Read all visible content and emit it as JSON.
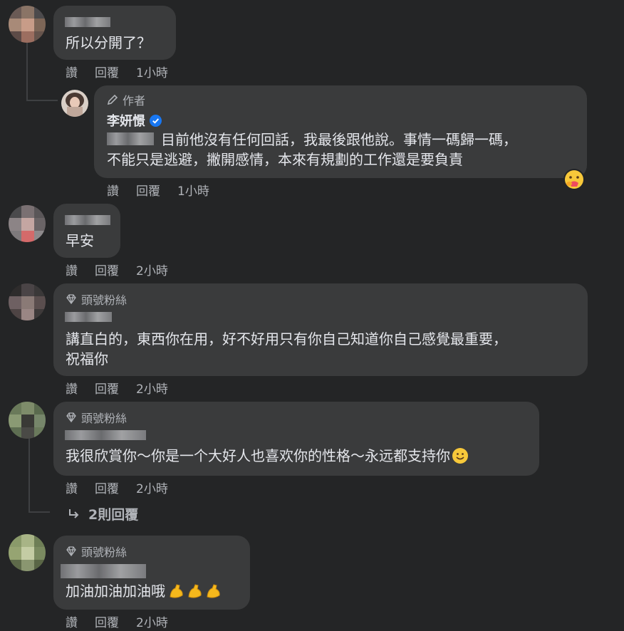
{
  "comments": [
    {
      "text": "所以分開了？",
      "like": "讚",
      "reply": "回覆",
      "time": "1小時"
    },
    {
      "badge": "作者",
      "author": "李妍憬",
      "text_line1": "目前他沒有任何回話，我最後跟他說。事情一碼歸一碼，",
      "text_line2": "不能只是逃避，撇開感情，本來有規劃的工作還是要負責",
      "like": "讚",
      "reply": "回覆",
      "time": "1小時"
    },
    {
      "text": "早安",
      "like": "讚",
      "reply": "回覆",
      "time": "2小時"
    },
    {
      "badge": "頭號粉絲",
      "text_line1": "講直白的，東西你在用，好不好用只有你自己知道你自己感覺最重要，",
      "text_line2": "祝福你",
      "like": "讚",
      "reply": "回覆",
      "time": "2小時"
    },
    {
      "badge": "頭號粉絲",
      "text": "我很欣賞你～你是一个大好人也喜欢你的性格～永远都支持你",
      "like": "讚",
      "reply": "回覆",
      "time": "2小時",
      "replies_link": "2則回覆"
    },
    {
      "badge": "頭號粉絲",
      "text": "加油加油加油哦",
      "like": "讚",
      "reply": "回覆",
      "time": "2小時"
    }
  ],
  "icons": {
    "pencil": "pencil-icon",
    "verified": "verified-badge-icon",
    "diamond": "diamond-icon",
    "reply_arrow": "reply-arrow-icon",
    "care": "care-reaction-icon",
    "smile": "smile-emoji",
    "muscle": "flexed-biceps-emoji"
  },
  "colors": {
    "background": "#242526",
    "bubble": "#3a3b3c",
    "text": "#e4e6eb",
    "secondary": "#b0b3b8",
    "verified": "#1877f2"
  }
}
